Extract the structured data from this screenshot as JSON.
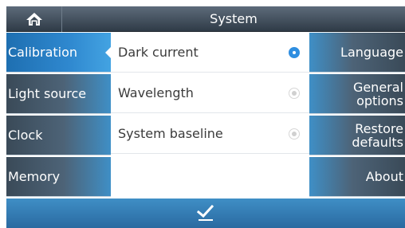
{
  "header": {
    "title": "System",
    "home_icon": "home-icon"
  },
  "left_nav": [
    {
      "label": "Calibration",
      "active": true
    },
    {
      "label": "Light source",
      "active": false
    },
    {
      "label": "Clock",
      "active": false
    },
    {
      "label": "Memory",
      "active": false
    }
  ],
  "options": [
    {
      "label": "Dark current",
      "selected": true
    },
    {
      "label": "Wavelength",
      "selected": false
    },
    {
      "label": "System baseline",
      "selected": false
    }
  ],
  "right_nav": [
    {
      "label": "Language"
    },
    {
      "label_line1": "General",
      "label_line2": "options"
    },
    {
      "label_line1": "Restore",
      "label_line2": "defaults"
    },
    {
      "label": "About"
    }
  ],
  "footer": {
    "confirm_icon": "checkmark-icon"
  },
  "colors": {
    "accent": "#2f8ee0",
    "header": "#3b4855",
    "footer": "#3f8fc6"
  }
}
